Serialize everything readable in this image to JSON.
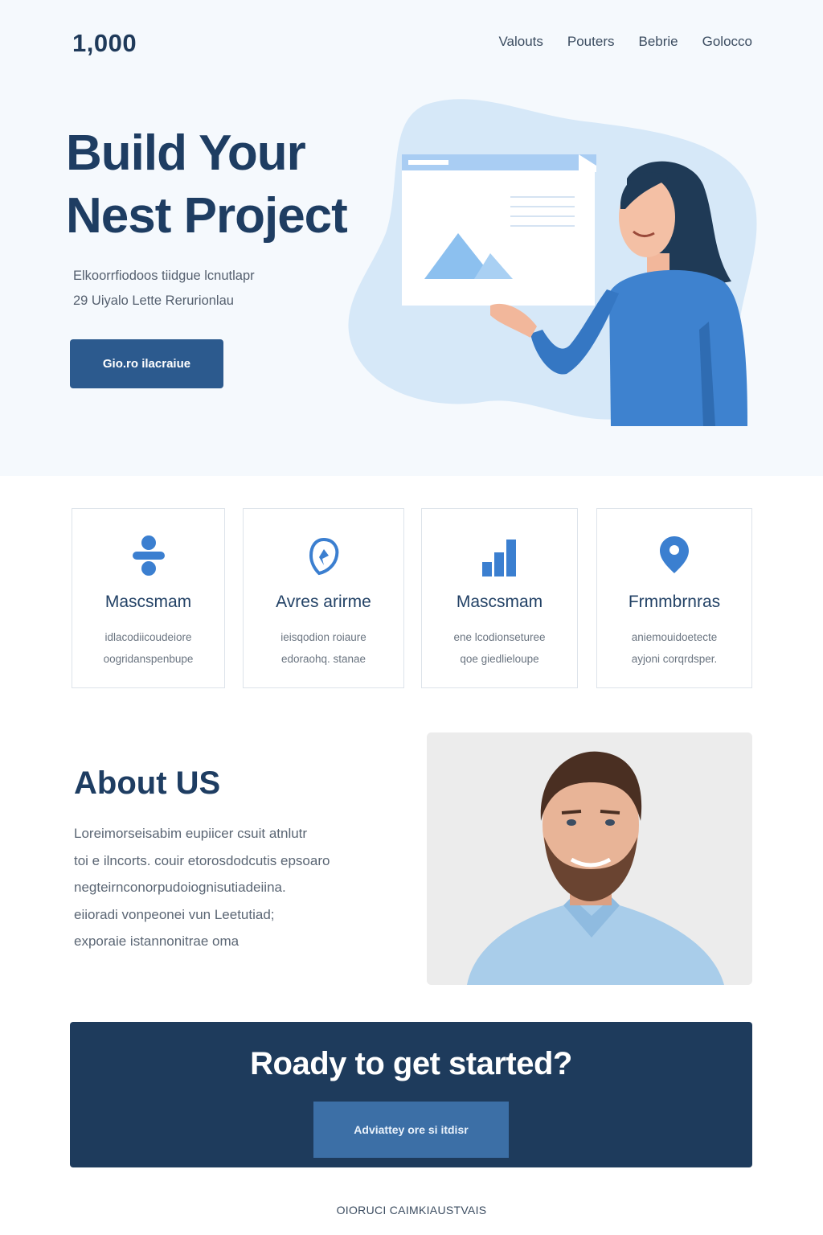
{
  "header": {
    "logo": "1,000",
    "nav": [
      "Valouts",
      "Pouters",
      "Bebrie",
      "Golocco"
    ]
  },
  "hero": {
    "title_line1": "Build Your",
    "title_line2": "Nest Project",
    "subtitle_line1": "Elkoorrfiodoos tiidgue lcnutlapr",
    "subtitle_line2": "29 Uiyalo Lette Rerurionlau",
    "cta_label": "Gio.ro ilacraiue"
  },
  "features": [
    {
      "icon": "plus-shapes-icon",
      "title": "Mascsmam",
      "desc_line1": "idlacodiicoudeiore",
      "desc_line2": "oogridanspenbupe"
    },
    {
      "icon": "shield-pin-icon",
      "title": "Avres arirme",
      "desc_line1": "ieisqodion roiaure",
      "desc_line2": "edoraohq. stanae"
    },
    {
      "icon": "bar-chart-icon",
      "title": "Mascsmam",
      "desc_line1": "ene lcodionseturee",
      "desc_line2": "qoe giedlieloupe"
    },
    {
      "icon": "map-pin-icon",
      "title": "Frmmbrnras",
      "desc_line1": "aniemouidoetecte",
      "desc_line2": "ayjoni corqrdsper."
    }
  ],
  "about": {
    "title": "About US",
    "lines": [
      "Loreimorseisabim eupiicer csuit atnlutr",
      "toi e ilncorts. couir etorosdodcutis epsoaro",
      "negteirnconorpudoiognisutiadeiina.",
      "eiioradi vonpeonei vun Leetutiad;",
      "exporaie istannonitrae oma"
    ]
  },
  "cta": {
    "title": "Roady to get started?",
    "button_label": "Adviattey ore si itdisr"
  },
  "footer": {
    "text": "OIORUCI CAIMKIAUSTVAIS"
  },
  "colors": {
    "primary": "#1e3b5c",
    "accent": "#3c7fd0",
    "button": "#2c5a8e",
    "hero_bg": "#f5f9fd"
  }
}
